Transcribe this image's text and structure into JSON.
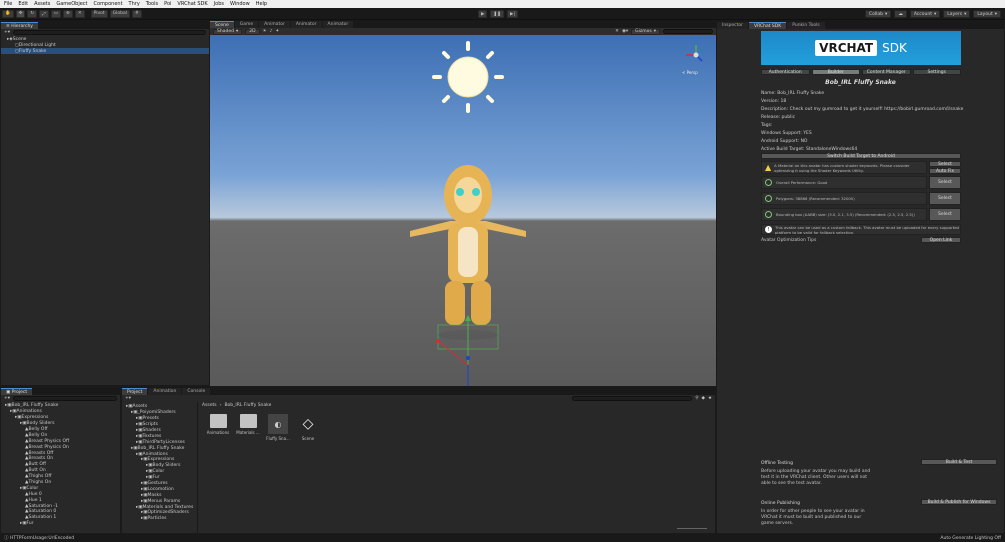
{
  "menu": [
    "File",
    "Edit",
    "Assets",
    "GameObject",
    "Component",
    "Thry",
    "Tools",
    "Poi",
    "VRChat SDK",
    "Jobs",
    "Window",
    "Help"
  ],
  "toolbar": {
    "pivot": "Pivot",
    "global": "Global",
    "collab": "Collab",
    "account": "Account",
    "layers": "Layers",
    "layout": "Layout"
  },
  "hierarchy": {
    "tab": "Hierarchy",
    "items": [
      "Scene",
      "Directional Light",
      "Fluffy Snake"
    ]
  },
  "scene_tabs": [
    "Scene",
    "Game",
    "Animator",
    "Animator",
    "Animator"
  ],
  "scene_toolbar": {
    "shading": "Shaded",
    "mode": "2D",
    "gizmos": "Gizmos",
    "search": "All"
  },
  "gizmo_label": "< Persp",
  "project_panel": {
    "tab": "Project",
    "tree": [
      {
        "label": "Bob_IRL Fluffy Snake",
        "indent": 0
      },
      {
        "label": "Animations",
        "indent": 1
      },
      {
        "label": "Expressions",
        "indent": 2
      },
      {
        "label": "Body Sliders",
        "indent": 3
      },
      {
        "label": "Belly Off",
        "indent": 4
      },
      {
        "label": "Belly On",
        "indent": 4
      },
      {
        "label": "Breast Physics Off",
        "indent": 4
      },
      {
        "label": "Breast Physics On",
        "indent": 4
      },
      {
        "label": "Breasts Off",
        "indent": 4
      },
      {
        "label": "Breasts On",
        "indent": 4
      },
      {
        "label": "Butt Off",
        "indent": 4
      },
      {
        "label": "Butt On",
        "indent": 4
      },
      {
        "label": "Thighs Off",
        "indent": 4
      },
      {
        "label": "Thighs On",
        "indent": 4
      },
      {
        "label": "Color",
        "indent": 3
      },
      {
        "label": "Hue 0",
        "indent": 4
      },
      {
        "label": "Hue 1",
        "indent": 4
      },
      {
        "label": "Saturation -1",
        "indent": 4
      },
      {
        "label": "Saturation 0",
        "indent": 4
      },
      {
        "label": "Saturation 1",
        "indent": 4
      },
      {
        "label": "Fur",
        "indent": 3
      }
    ]
  },
  "assets_panel": {
    "tabs": [
      "Project",
      "Animation",
      "Console"
    ],
    "tree": [
      {
        "label": "Assets",
        "indent": 0
      },
      {
        "label": "_PoiyomiShaders",
        "indent": 1
      },
      {
        "label": "Presets",
        "indent": 2
      },
      {
        "label": "Scripts",
        "indent": 2
      },
      {
        "label": "Shaders",
        "indent": 2
      },
      {
        "label": "Textures",
        "indent": 2
      },
      {
        "label": "ThirdPartyLicenses",
        "indent": 2
      },
      {
        "label": "Bob_IRL Fluffy Snake",
        "indent": 1
      },
      {
        "label": "Animations",
        "indent": 2
      },
      {
        "label": "Expressions",
        "indent": 3
      },
      {
        "label": "Body Sliders",
        "indent": 4
      },
      {
        "label": "Color",
        "indent": 4
      },
      {
        "label": "Fur",
        "indent": 4
      },
      {
        "label": "Gestures",
        "indent": 3
      },
      {
        "label": "Locomotion",
        "indent": 3
      },
      {
        "label": "Masks",
        "indent": 3
      },
      {
        "label": "Menus Params",
        "indent": 3
      },
      {
        "label": "Materials and Textures",
        "indent": 2
      },
      {
        "label": "OptimizedShaders",
        "indent": 3
      },
      {
        "label": "Particles",
        "indent": 3
      }
    ],
    "breadcrumb": [
      "Assets",
      "Bob_IRL Fluffy Snake"
    ],
    "items": [
      "Animations",
      "Materials ...",
      "Fluffy Sna...",
      "Scene"
    ]
  },
  "inspector": {
    "tabs": [
      "Inspector",
      "VRChat SDK",
      "Punkin Tools"
    ],
    "logo_left": "VRCHAT",
    "logo_right": "SDK",
    "sdk_tabs": [
      "Authentication",
      "Builder",
      "Content Manager",
      "Settings"
    ],
    "avatar_title": "Bob_IRL Fluffy Snake",
    "info": [
      "Name: Bob_IRL Fluffy Snake",
      "Version: 18",
      "Description: Check out my gumroad to get it yourself! https://bobirl.gumroad.com/l/snake",
      "Release: public",
      "Tags:",
      "Windows Support: YES",
      "Android Support: NO",
      "Active Build Target: StandaloneWindows64"
    ],
    "switch_button": "Switch Build Target to Android",
    "warning": "A Material on this avatar has custom shader keywords. Please consider optimizing it using the Shader Keywords Utility.",
    "warning_buttons": [
      "Select",
      "Auto Fix"
    ],
    "checks": [
      {
        "text": "Overall Performance: Good",
        "button": "Select"
      },
      {
        "text": "Polygons: 38866 (Recommended: 32000)",
        "button": "Select"
      },
      {
        "text": "Bounding box (AABB) size: (3.0, 2.1, 3.5) (Recommended: (2.5, 2.5, 2.5))",
        "button": "Select"
      }
    ],
    "info_box": "This avatar can be used as a custom fallback. This avatar must be uploaded for every supported platform to be valid for fallback selection.",
    "tips_label": "Avatar Optimization Tips",
    "tips_button": "Open Link",
    "offline_title": "Offline Testing",
    "offline_text": "Before uploading your avatar you may build and test it in the VRChat client. Other users will not able to see the test avatar.",
    "offline_button": "Build & Test",
    "online_title": "Online Publishing",
    "online_text": "In order for other people to see your avatar in VRChat it must be built and published to our game servers.",
    "online_button": "Build & Publish for Windows"
  },
  "status": {
    "left": "HTTPFormUsage:UrlEncoded",
    "right": "Auto Generate Lighting Off"
  }
}
